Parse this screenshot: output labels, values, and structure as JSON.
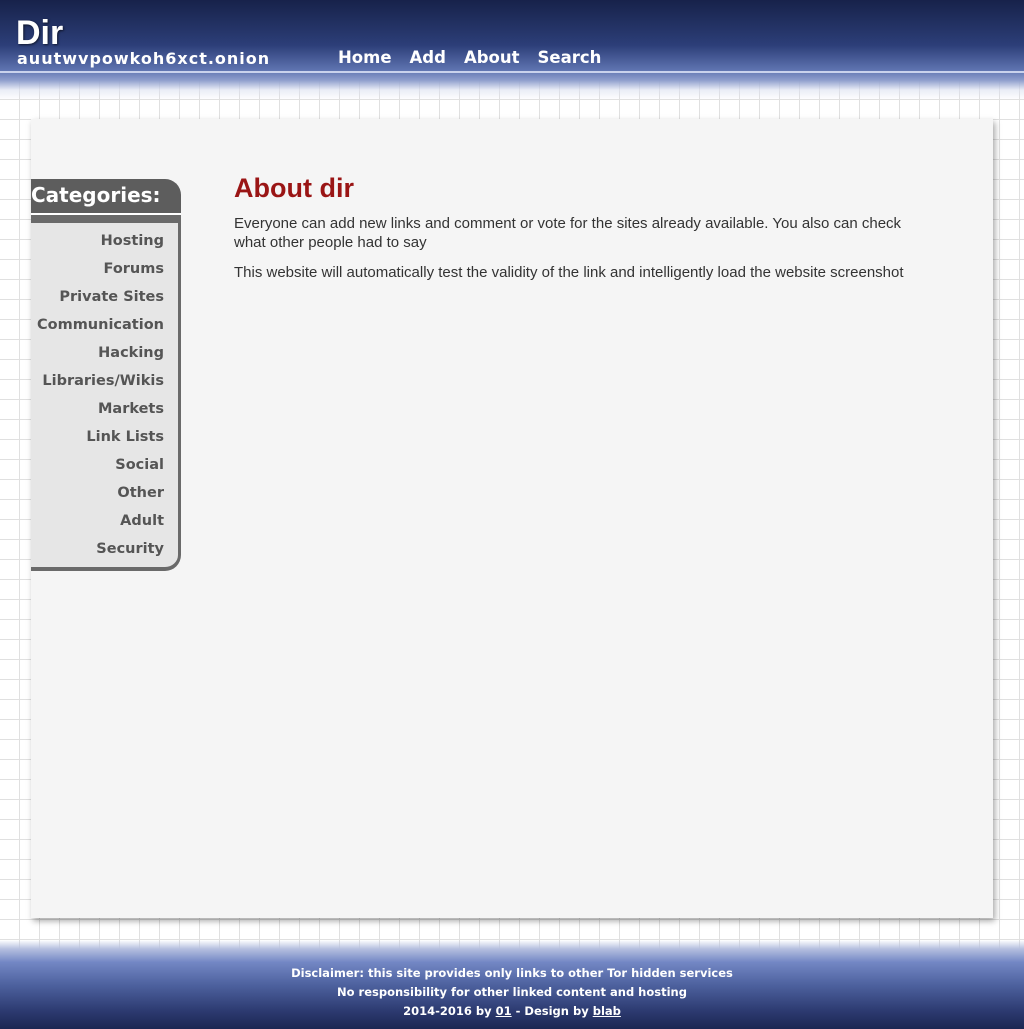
{
  "header": {
    "logo": "Dir",
    "onion": "auutwvpowkoh6xct.onion",
    "nav": [
      "Home",
      "Add",
      "About",
      "Search"
    ]
  },
  "sidebar": {
    "title": "Categories:",
    "items": [
      "Hosting",
      "Forums",
      "Private Sites",
      "Communication",
      "Hacking",
      "Libraries/Wikis",
      "Markets",
      "Link Lists",
      "Social",
      "Other",
      "Adult",
      "Security"
    ]
  },
  "main": {
    "title": "About dir",
    "paragraphs": [
      "Everyone can add new links and comment or vote for the sites already available. You also can check what other people had to say",
      "This website will automatically test the validity of the link and intelligently load the website screenshot"
    ]
  },
  "footer": {
    "line1": "Disclaimer: this site provides only links to other Tor hidden services",
    "line2": "No responsibility for other linked content and hosting",
    "line3_prefix": "2014-2016 by ",
    "line3_author": "01",
    "line3_mid": " - Design by ",
    "line3_designer": "blab"
  },
  "colors": {
    "header_dark": "#17224a",
    "title_red": "#9a1515",
    "sidebar_dark": "#5d5d5d"
  }
}
